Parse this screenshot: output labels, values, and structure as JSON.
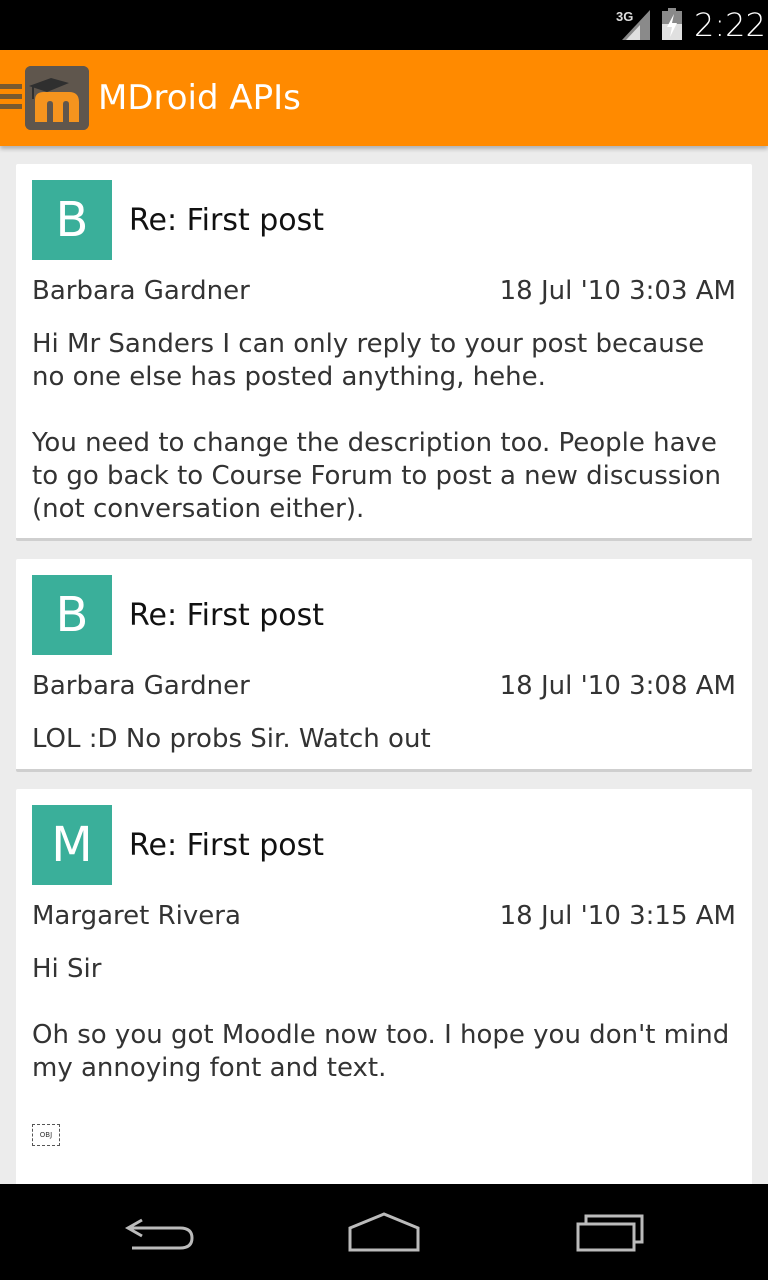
{
  "status_bar": {
    "network": "3G",
    "time": "2:22"
  },
  "action_bar": {
    "title": "MDroid APIs",
    "logo_icon": "moodle-logo-icon",
    "drawer_icon": "menu-icon",
    "colors": {
      "background": "#ff8a00",
      "title": "#ffffff"
    }
  },
  "posts": [
    {
      "avatar_letter": "B",
      "subject": "Re: First post",
      "author": "Barbara Gardner",
      "date": "18 Jul '10 3:03 AM",
      "body": "Hi Mr Sanders I can only reply to your post because no one else has posted anything, hehe.\n\nYou need to change the description too. People have to go back to Course Forum to post a new discussion (not conversation either)."
    },
    {
      "avatar_letter": "B",
      "subject": "Re: First post",
      "author": "Barbara Gardner",
      "date": "18 Jul '10 3:08 AM",
      "body": "LOL :D No probs Sir. Watch out"
    },
    {
      "avatar_letter": "M",
      "subject": "Re: First post",
      "author": "Margaret Rivera",
      "date": "18 Jul '10 3:15 AM",
      "body": "Hi Sir\n\nOh so you got Moodle now too. I hope you don't mind my annoying font and text.",
      "embedded_object_label": "OBJ"
    }
  ],
  "colors": {
    "avatar": "#3aaf9a"
  },
  "nav_bar": {
    "back_icon": "back-icon",
    "home_icon": "home-icon",
    "recents_icon": "recent-apps-icon"
  }
}
